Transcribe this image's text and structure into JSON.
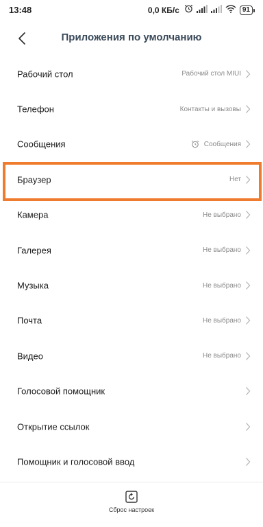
{
  "status_bar": {
    "time": "13:48",
    "net_speed": "0,0 КБ/с",
    "battery": "91",
    "icons": [
      "alarm-icon",
      "signal-icon",
      "signal-icon",
      "wifi-icon",
      "battery-icon"
    ]
  },
  "header": {
    "title": "Приложения по умолчанию",
    "back_icon": "back-arrow-icon"
  },
  "items": [
    {
      "label": "Рабочий стол",
      "value": "Рабочий стол MIUI"
    },
    {
      "label": "Телефон",
      "value": "Контакты и вызовы"
    },
    {
      "label": "Сообщения",
      "value": "Сообщения",
      "icon": "alarm-icon"
    },
    {
      "label": "Браузер",
      "value": "Нет",
      "highlighted": true
    },
    {
      "label": "Камера",
      "value": "Не выбрано"
    },
    {
      "label": "Галерея",
      "value": "Не выбрано"
    },
    {
      "label": "Музыка",
      "value": "Не выбрано"
    },
    {
      "label": "Почта",
      "value": "Не выбрано"
    },
    {
      "label": "Видео",
      "value": "Не выбрано"
    },
    {
      "label": "Голосовой помощник",
      "value": ""
    },
    {
      "label": "Открытие ссылок",
      "value": ""
    },
    {
      "label": "Помощник и голосовой ввод",
      "value": ""
    }
  ],
  "bottom": {
    "reset_label": "Сброс настроек",
    "reset_icon": "reset-icon"
  },
  "colors": {
    "highlight": "#ef7c2e",
    "title": "#3a4a5a",
    "value_text": "#8a8a8a"
  }
}
